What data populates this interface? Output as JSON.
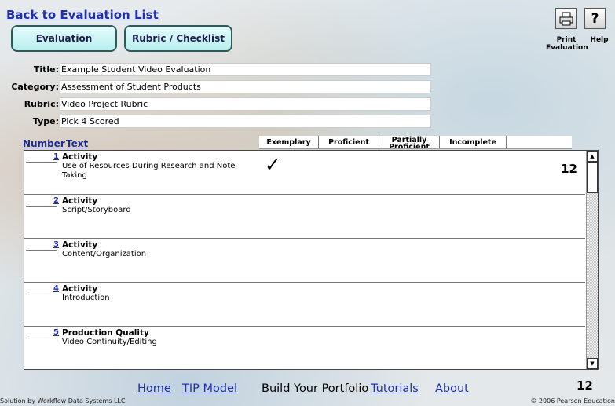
{
  "header": {
    "back_link": "Back to Evaluation List",
    "tabs": [
      "Evaluation",
      "Rubric / Checklist"
    ],
    "print_label": "Print Evaluation",
    "help_label": "Help",
    "help_glyph": "?"
  },
  "meta": {
    "title_label": "Title:",
    "title_value": "Example Student Video Evaluation",
    "category_label": "Category:",
    "category_value": "Assessment of Student Products",
    "rubric_label": "Rubric:",
    "rubric_value": "Video Project Rubric",
    "type_label": "Type:",
    "type_value": "Pick 4 Scored"
  },
  "columns": {
    "number": "Number",
    "text": "Text",
    "ratings": [
      "Exemplary",
      "Proficient",
      "Partially Proficient",
      "Incomplete",
      ""
    ]
  },
  "rows": [
    {
      "num": "1",
      "category": "Activity",
      "text": "Use of Resources During Research and Note Taking",
      "check": "✓",
      "score": "12"
    },
    {
      "num": "2",
      "category": "Activity",
      "text": "Script/Storyboard",
      "check": "",
      "score": ""
    },
    {
      "num": "3",
      "category": "Activity",
      "text": "Content/Organization",
      "check": "",
      "score": ""
    },
    {
      "num": "4",
      "category": "Activity",
      "text": "Introduction",
      "check": "",
      "score": ""
    },
    {
      "num": "5",
      "category": "Production Quality",
      "text": "Video Continuity/Editing",
      "check": "",
      "score": ""
    }
  ],
  "footer": {
    "nav": [
      "Home",
      "TIP Model",
      "Build Your Portfolio",
      "Tutorials",
      "About"
    ],
    "total": "12",
    "left_credit": "Solution by Workflow Data Systems LLC",
    "right_credit": "© 2006 Pearson Education"
  }
}
